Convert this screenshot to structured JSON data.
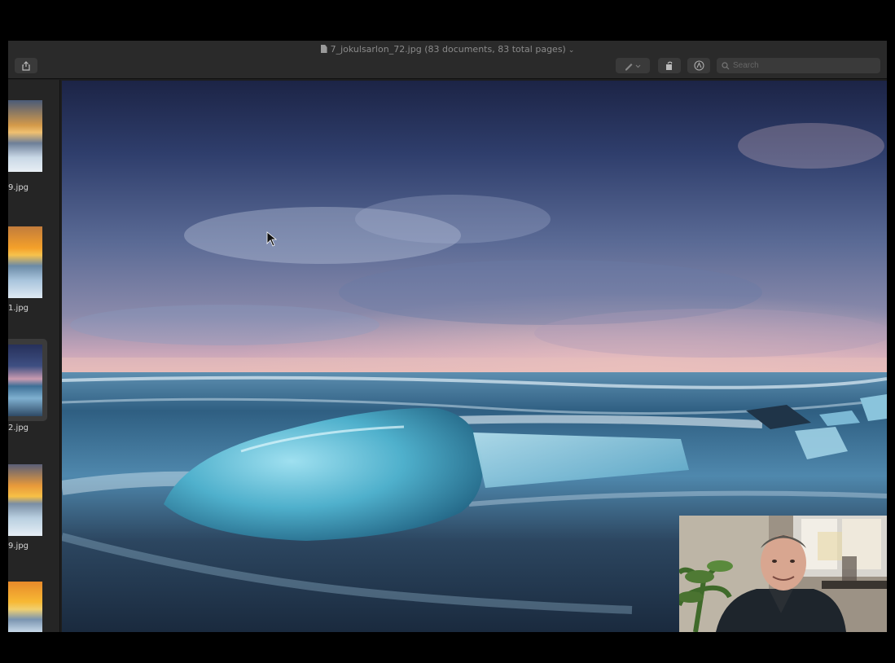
{
  "window": {
    "title": "7_jokulsarlon_72.jpg (83 documents, 83 total pages)"
  },
  "toolbar": {
    "share_icon": "share-icon",
    "markup_icon": "pencil-markup-icon",
    "rotate_icon": "rotate-icon",
    "annotate_icon": "annotate-icon",
    "search": {
      "placeholder": "Search",
      "value": ""
    }
  },
  "sidebar": {
    "items": [
      {
        "label": "9.jpg",
        "selected": false
      },
      {
        "label": "1.jpg",
        "selected": false
      },
      {
        "label": "2.jpg",
        "selected": true
      },
      {
        "label": "9.jpg",
        "selected": false
      },
      {
        "label": "",
        "selected": false
      }
    ]
  },
  "main": {
    "image_subject": "ice-block-on-black-sand-beach-stormy-sky"
  },
  "webcam": {
    "subject": "presenter-webcam-overlay"
  }
}
